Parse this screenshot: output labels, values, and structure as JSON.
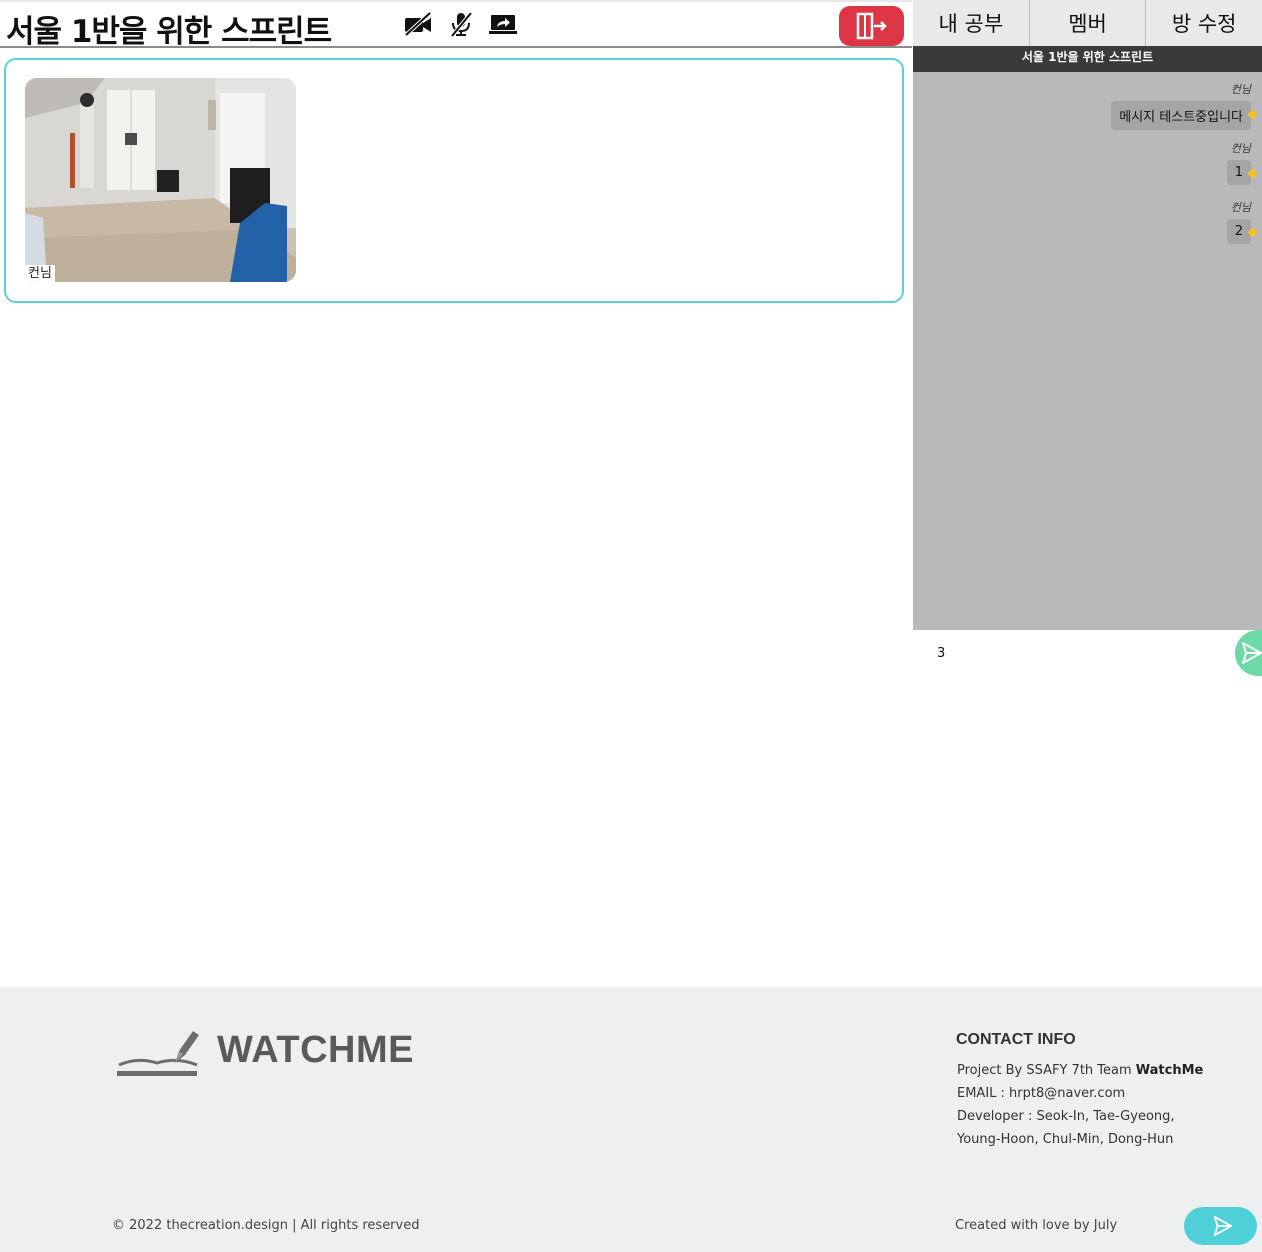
{
  "room": {
    "title": "서울 1반을 위한 스프린트"
  },
  "controls": {
    "camera_icon": "video-off-icon",
    "mic_icon": "mic-off-icon",
    "screen_share_icon": "screen-share-icon",
    "exit_icon": "exit-door-icon",
    "exit_color": "#dc3545"
  },
  "video": {
    "participant_name": "컨님",
    "border_color": "#5bcfda"
  },
  "tabs": [
    {
      "label": "내 공부"
    },
    {
      "label": "멤버"
    },
    {
      "label": "방 수정"
    }
  ],
  "chat": {
    "title": "서울 1반을 위한 스프린트",
    "messages": [
      {
        "sender": "컨님",
        "text": "메시지 테스트중입니다"
      },
      {
        "sender": "컨님",
        "text": "1"
      },
      {
        "sender": "컨님",
        "text": "2"
      }
    ],
    "input_value": "3",
    "send_icon": "send-icon",
    "send_color": "#6dd9a7"
  },
  "footer": {
    "brand": "WATCHME",
    "contact_title": "CONTACT INFO",
    "project_prefix": "Project By SSAFY 7th Team ",
    "project_team": "WatchMe",
    "email": "EMAIL : hrpt8@naver.com",
    "developers": "Developer : Seok-In, Tae-Gyeong, Young-Hoon, Chul-Min, Dong-Hun",
    "copyright": "© 2022 thecreation.design | All rights reserved",
    "created_by": "Created with love by July",
    "send_icon": "send-icon",
    "send_color": "#4fd0d8"
  }
}
